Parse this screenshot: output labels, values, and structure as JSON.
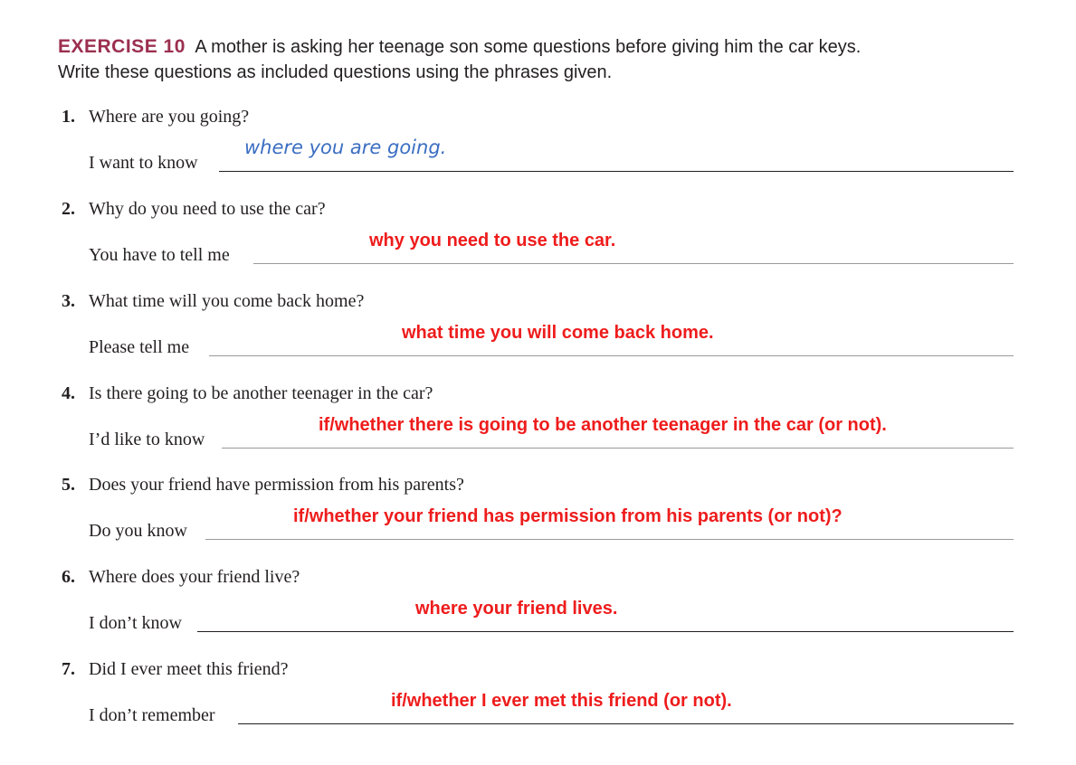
{
  "header": {
    "label": "EXERCISE 10",
    "line1": "A mother is asking her teenage son some questions before giving him the car keys.",
    "line2": "Write these questions as included questions using the phrases given."
  },
  "items": [
    {
      "num": "1.",
      "question": "Where are you going?",
      "stem": "I want to know",
      "answer": "where you are going."
    },
    {
      "num": "2.",
      "question": "Why do you need to use the car?",
      "stem": "You have to tell me",
      "answer": "why you need to use the car."
    },
    {
      "num": "3.",
      "question": "What time will you come back home?",
      "stem": "Please tell me",
      "answer": "what time you will come back home."
    },
    {
      "num": "4.",
      "question": "Is there going to be another teenager in the car?",
      "stem": "I’d like to know",
      "answer": "if/whether there is going to be another teenager in the car (or not)."
    },
    {
      "num": "5.",
      "question": "Does your friend have permission from his parents?",
      "stem": "Do you know",
      "answer": "if/whether your friend has permission from his parents (or not)?"
    },
    {
      "num": "6.",
      "question": "Where does your friend live?",
      "stem": "I don’t know",
      "answer": "where your friend lives."
    },
    {
      "num": "7.",
      "question": "Did I ever meet this friend?",
      "stem": "I don’t remember",
      "answer": "if/whether I ever met this friend (or not)."
    }
  ]
}
